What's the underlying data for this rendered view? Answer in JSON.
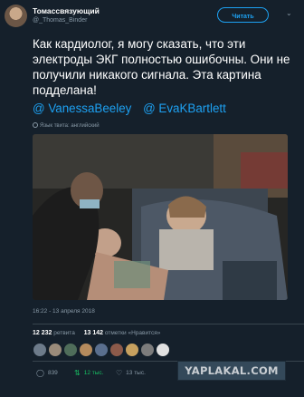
{
  "author": {
    "name": "Томассвязующий",
    "handle": "@_Thomas_Binder"
  },
  "follow_button": "Читать",
  "tweet": {
    "text": "Как кардиолог, я могу сказать, что эти электроды ЭКГ полностью ошибочны. Они не получили никакого сигнала. Эта картина подделана!",
    "mentions": [
      "@ VanessaBeeley",
      "@ EvaKBartlett"
    ],
    "translation_note": "Язык твита: английский"
  },
  "timestamp": "16:22 - 13 апреля 2018",
  "stats": {
    "retweets_count": "12 232",
    "retweets_label": "ретвита",
    "likes_count": "13 142",
    "likes_label": "отметки «Нравится»"
  },
  "actions": {
    "reply_count": "839",
    "retweet_count": "12 тыс.",
    "like_count": "13 тыс."
  },
  "watermark": "YAPLAKAL.COM",
  "icons": [
    "reply-icon",
    "retweet-icon",
    "like-icon",
    "message-icon",
    "chevron-down-icon",
    "globe-icon"
  ],
  "colors": {
    "background": "#15202b",
    "accent": "#1da1f2",
    "retweet_green": "#17bf63",
    "muted": "#8899a6"
  }
}
